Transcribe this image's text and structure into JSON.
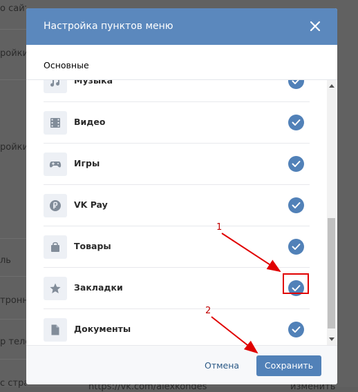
{
  "background": {
    "snippets": [
      "о сайт",
      "ройки",
      "ройки",
      "ль",
      "тронна",
      "р теле",
      "с страницы",
      "https://vk.com/alexkondes",
      "изменить"
    ]
  },
  "modal": {
    "title": "Настройка пунктов меню",
    "tab": "Основные",
    "items": [
      {
        "label": "Музыка",
        "icon": "music-note-icon",
        "checked": true
      },
      {
        "label": "Видео",
        "icon": "film-icon",
        "checked": true
      },
      {
        "label": "Игры",
        "icon": "gamepad-icon",
        "checked": true
      },
      {
        "label": "VK Pay",
        "icon": "ruble-coin-icon",
        "checked": true
      },
      {
        "label": "Товары",
        "icon": "shopping-bag-icon",
        "checked": true
      },
      {
        "label": "Закладки",
        "icon": "star-icon",
        "checked": true
      },
      {
        "label": "Документы",
        "icon": "document-icon",
        "checked": true
      }
    ],
    "cancel_label": "Отмена",
    "save_label": "Сохранить"
  },
  "annotations": {
    "label_1": "1",
    "label_2": "2"
  },
  "colors": {
    "header": "#5b88bd",
    "accent": "#5181b8",
    "annotation": "#e00000"
  }
}
